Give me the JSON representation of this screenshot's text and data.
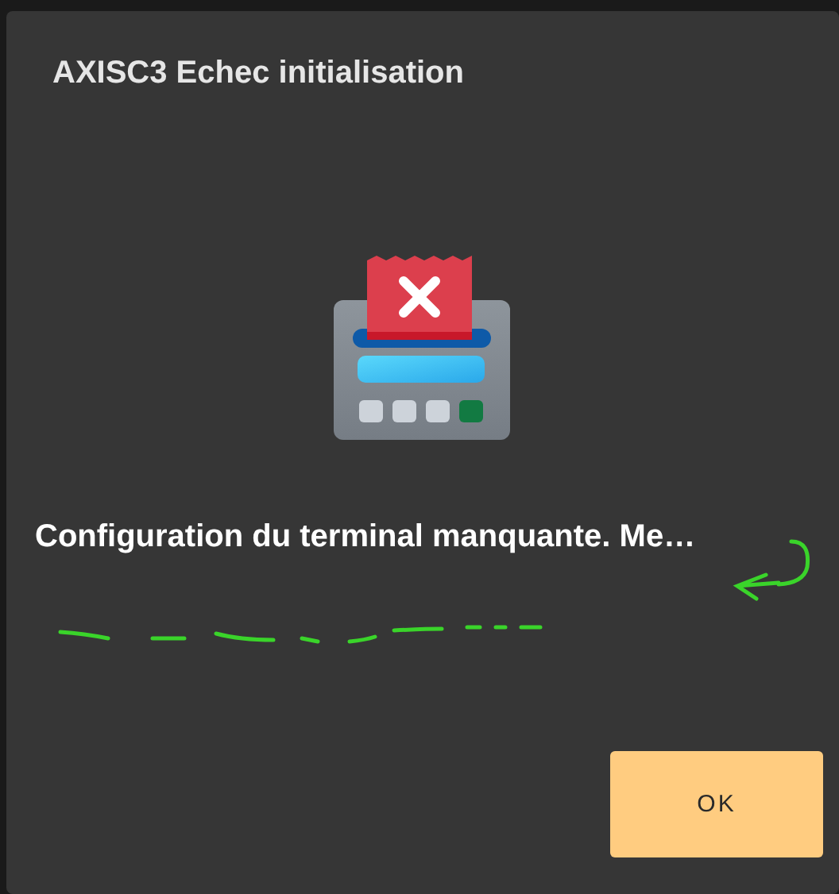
{
  "dialog": {
    "title": "AXISC3 Echec initialisation",
    "message": "Configuration du terminal manquante. Me…",
    "buttons": [
      "OK"
    ]
  }
}
